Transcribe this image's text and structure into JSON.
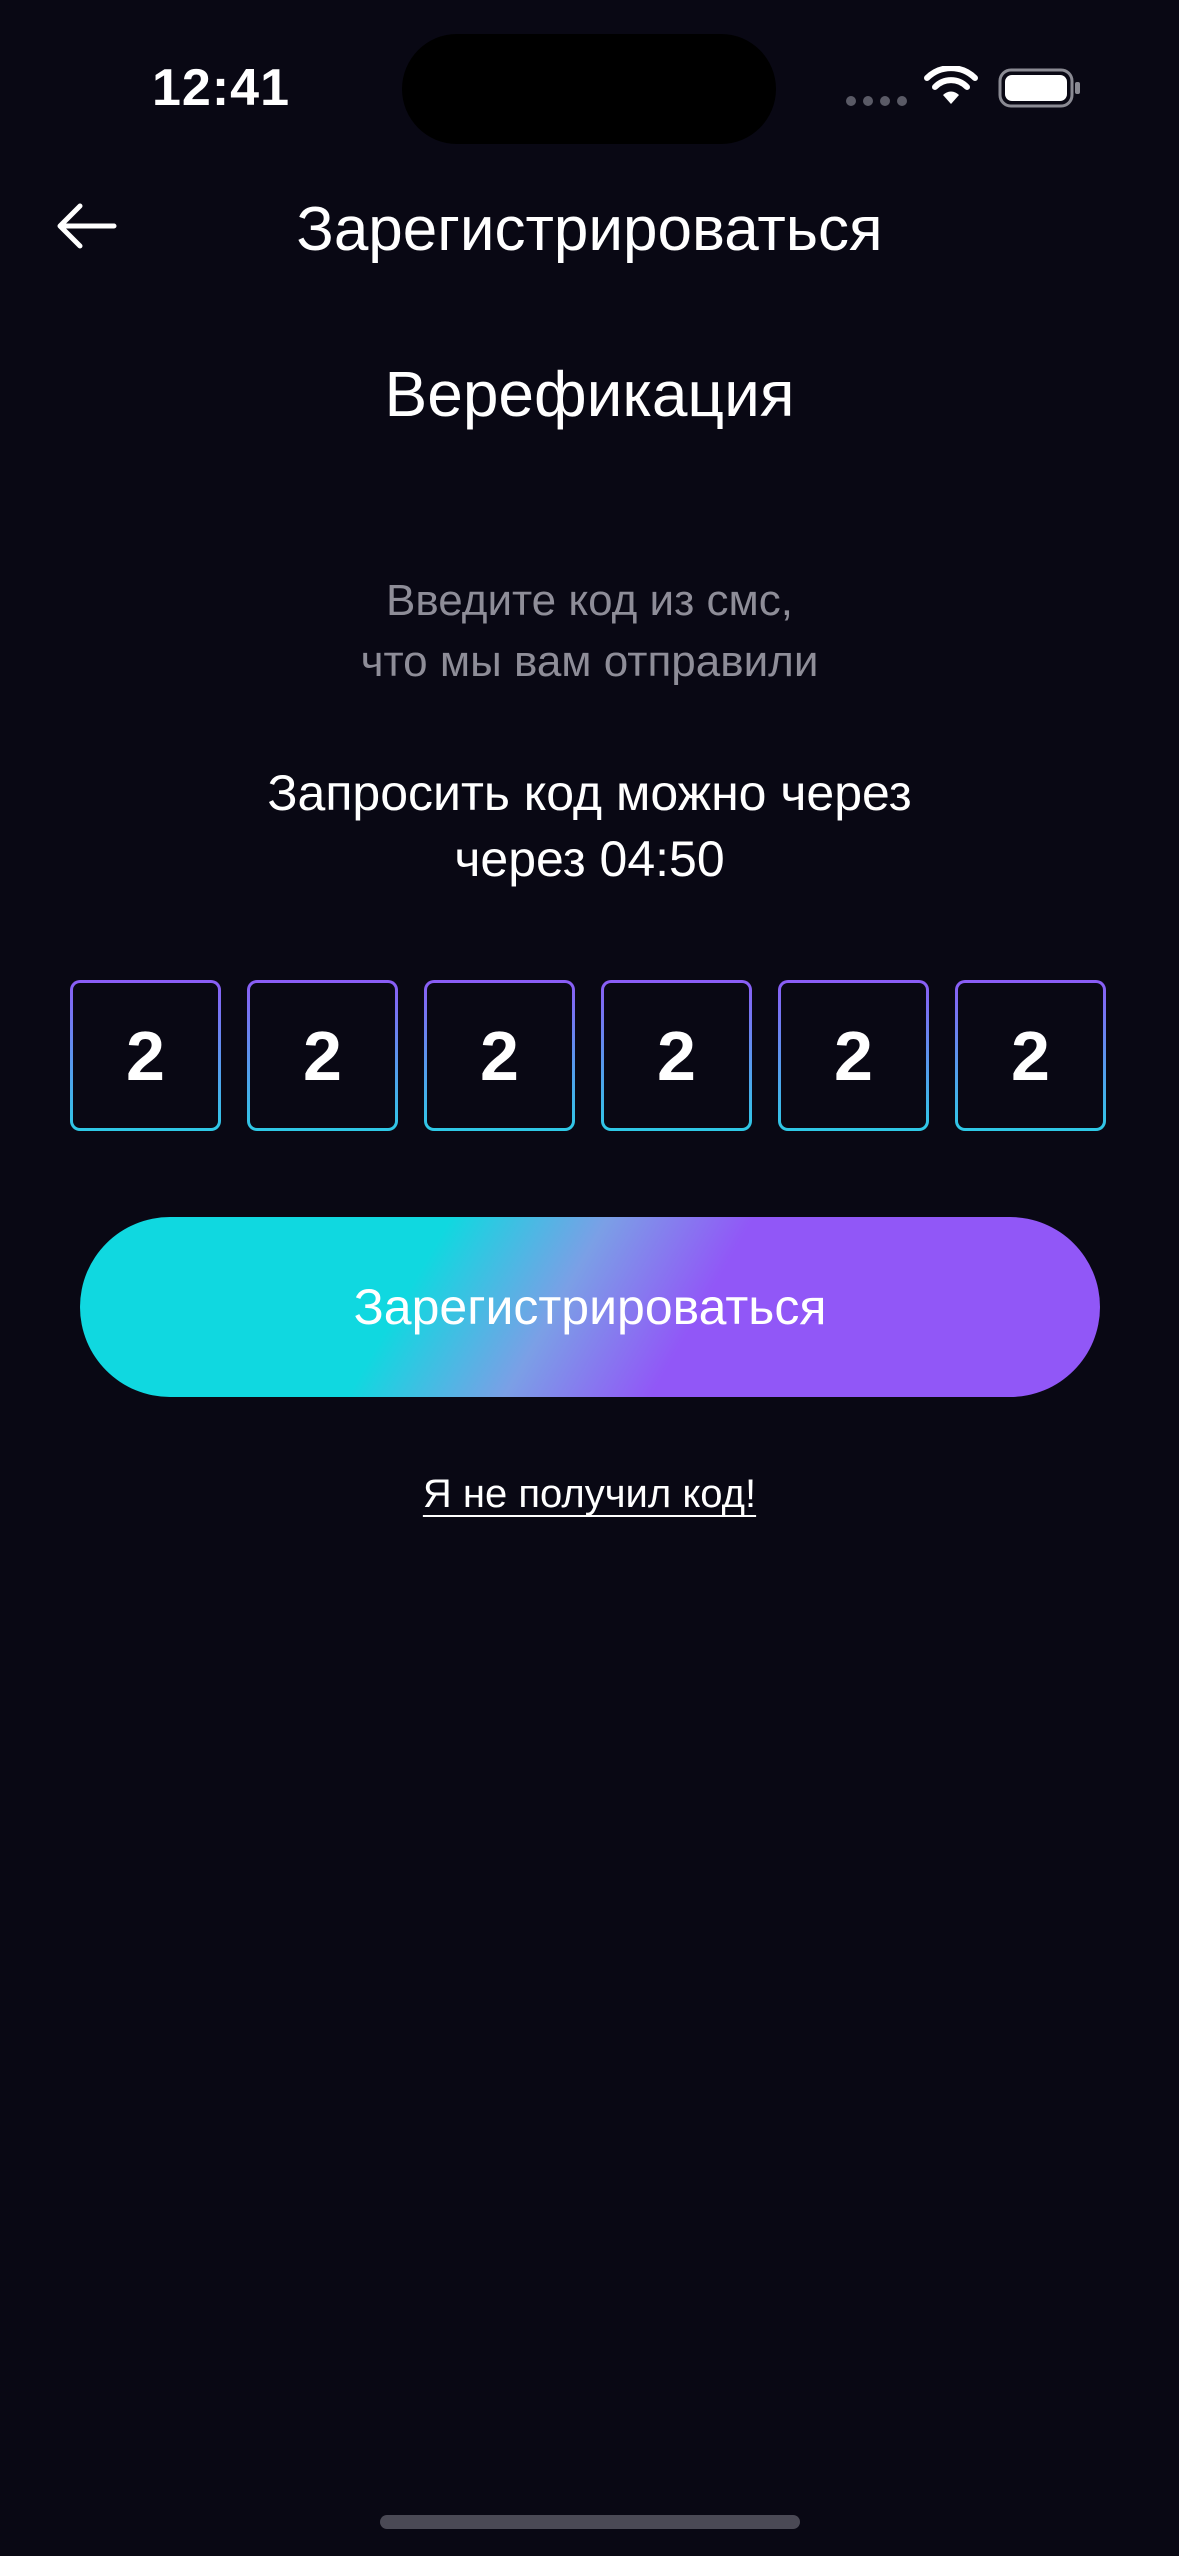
{
  "status_bar": {
    "time": "12:41",
    "icons": [
      "signal-dots-icon",
      "wifi-icon",
      "battery-icon"
    ]
  },
  "header": {
    "back_icon": "arrow-left-icon",
    "title": "Зарегистрироваться"
  },
  "main": {
    "title": "Верефикация",
    "instruction_line1": "Введите код из смс,",
    "instruction_line2": "что мы вам отправили",
    "timer_line1": "Запросить код можно через",
    "timer_line2": "через 04:50",
    "code_digits": [
      "2",
      "2",
      "2",
      "2",
      "2",
      "2"
    ],
    "register_label": "Зарегистрироваться",
    "resend_label": "Я не получил код!"
  },
  "colors": {
    "background": "#090814",
    "accent_cyan": "#10d8e0",
    "accent_purple": "#9157f7",
    "muted_text": "#8e8d98"
  }
}
